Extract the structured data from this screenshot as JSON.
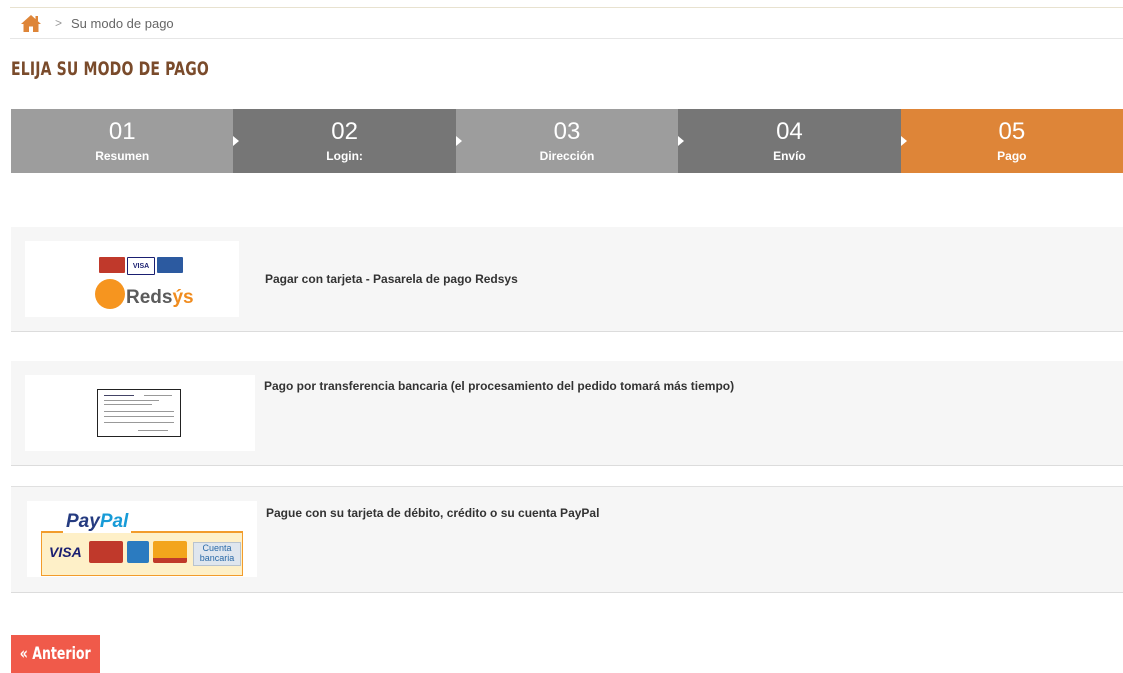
{
  "breadcrumb": {
    "home_icon": "home-icon",
    "separator": ">",
    "current": "Su modo de pago"
  },
  "page_title": "ELIJA SU MODO DE PAGO",
  "steps": [
    {
      "number": "01",
      "label": "Resumen"
    },
    {
      "number": "02",
      "label": "Login:"
    },
    {
      "number": "03",
      "label": "Dirección"
    },
    {
      "number": "04",
      "label": "Envío"
    },
    {
      "number": "05",
      "label": "Pago",
      "active": true
    }
  ],
  "payment_options": [
    {
      "label": "Pagar con tarjeta - Pasarela de pago Redsys",
      "logo": "redsys-logo",
      "logo_text": "Redsýs"
    },
    {
      "label": "Pago por transferencia bancaria (el procesamiento del pedido tomará más tiempo)",
      "logo": "bank-transfer-document"
    },
    {
      "label": "Pague con su tarjeta de débito, crédito o su cuenta PayPal",
      "logo": "paypal-logo",
      "logo_text": "PayPal",
      "card_text": "VISA",
      "extra_text": "Cuenta bancaria"
    }
  ],
  "back_button": "« Anterior",
  "colors": {
    "accent": "#de8538",
    "title": "#7a4b2b",
    "step_light": "#9d9d9d",
    "step_dark": "#767676",
    "button": "#f05a4a"
  }
}
